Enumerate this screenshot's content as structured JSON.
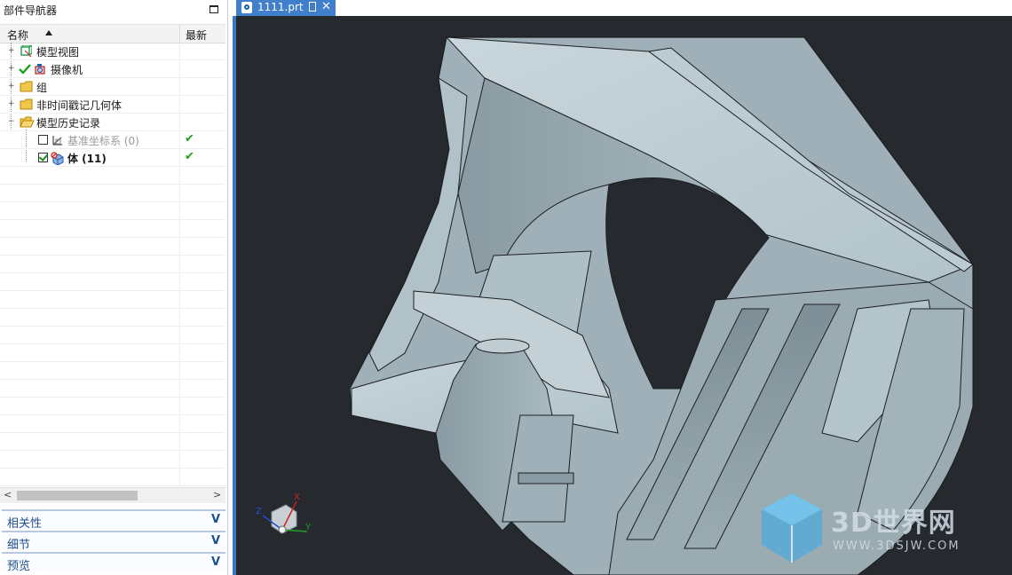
{
  "navigator": {
    "title": "部件导航器",
    "columns": {
      "name": "名称",
      "latest": "最新"
    },
    "items": [
      {
        "label": "模型视图",
        "icon": "model-views-icon",
        "expander": "+",
        "level": 0,
        "latest": ""
      },
      {
        "label": "摄像机",
        "icon": "camera-icon",
        "expander": "+",
        "level": 0,
        "latest": ""
      },
      {
        "label": "组",
        "icon": "folder-icon",
        "expander": "+",
        "level": 0,
        "latest": ""
      },
      {
        "label": "非时间戳记几何体",
        "icon": "folder-icon",
        "expander": "+",
        "level": 0,
        "latest": ""
      },
      {
        "label": "模型历史记录",
        "icon": "folder-open-icon",
        "expander": "−",
        "level": 0,
        "latest": ""
      },
      {
        "label": "基准坐标系 (0)",
        "icon": "datum-csys-icon",
        "level": 1,
        "checked": false,
        "latest": "✔"
      },
      {
        "label": "体 (11)",
        "icon": "body-icon",
        "level": 1,
        "checked": true,
        "latest": "✔"
      }
    ]
  },
  "panels": [
    {
      "label": "相关性",
      "chevron": "V"
    },
    {
      "label": "细节",
      "chevron": "V"
    },
    {
      "label": "预览",
      "chevron": "V"
    }
  ],
  "tab": {
    "label": "1111.prt",
    "close": "✕"
  },
  "triad": {
    "x": "X",
    "y": "Y",
    "z": "Z"
  },
  "watermark": {
    "text": "3D世界网",
    "sub": "WWW.3DSJW.COM"
  },
  "colors": {
    "accent": "#3f7fcc",
    "viewport_bg": "#26292e",
    "model": "#aebfc6",
    "check": "#20a020"
  }
}
